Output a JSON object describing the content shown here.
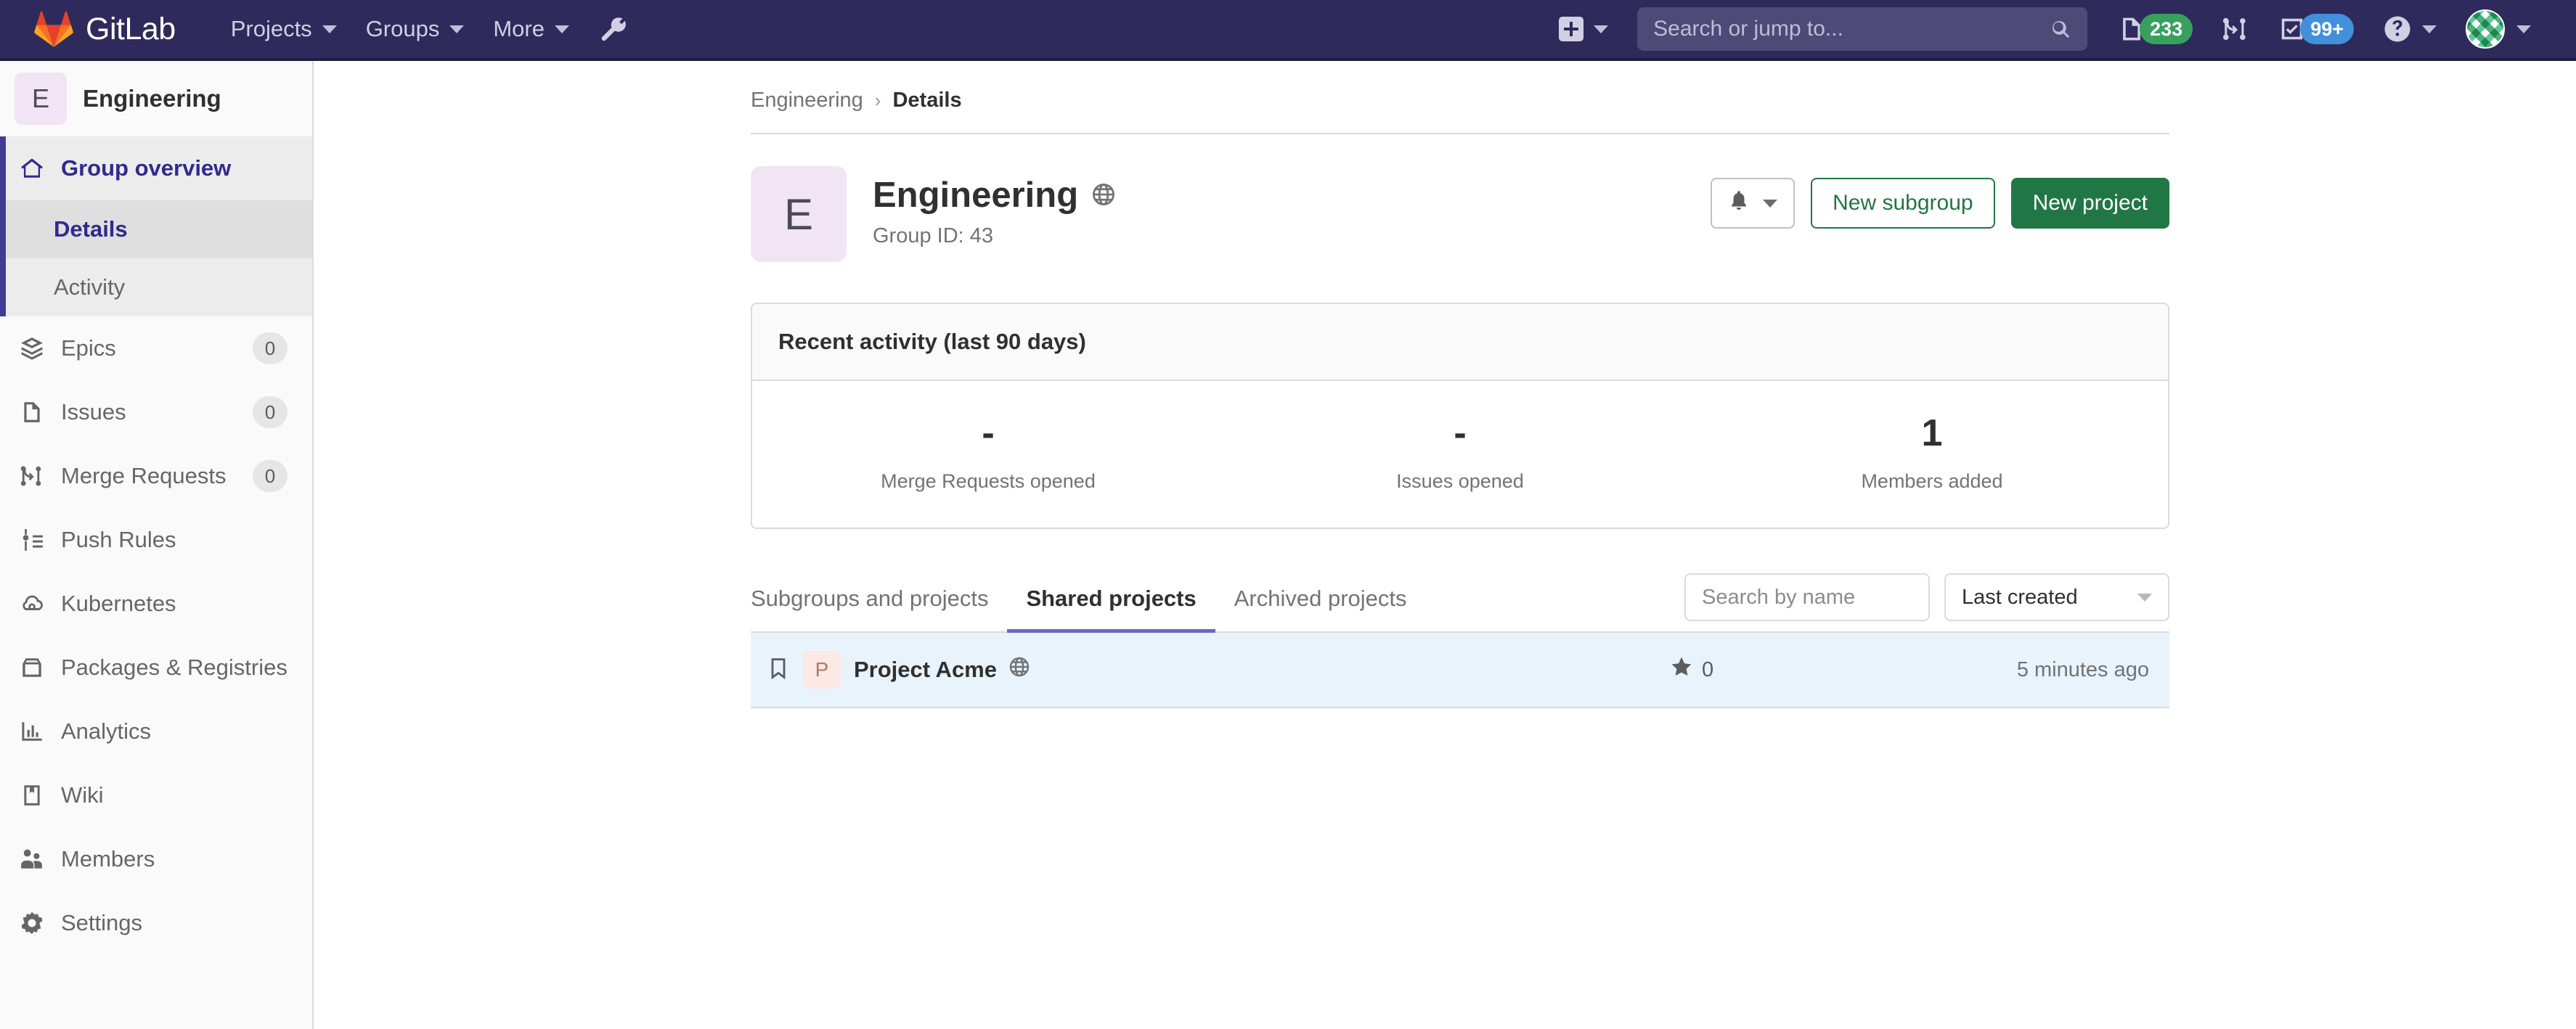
{
  "navbar": {
    "brand": "GitLab",
    "items": [
      {
        "label": "Projects",
        "icon": "chevron-down-icon"
      },
      {
        "label": "Groups",
        "icon": "chevron-down-icon"
      },
      {
        "label": "More",
        "icon": "chevron-down-icon"
      }
    ],
    "wrench_icon": "wrench-icon",
    "create_icon": "plus-square-icon",
    "search": {
      "placeholder": "Search or jump to...",
      "value": "",
      "icon": "search-icon"
    },
    "issues": {
      "icon": "issues-icon",
      "badge": "233",
      "badge_color": "#37a05d"
    },
    "merge_requests": {
      "icon": "merge-request-icon"
    },
    "todos": {
      "icon": "todo-checkbox-icon",
      "badge": "99+",
      "badge_color": "#428fdc"
    },
    "help": {
      "icon": "question-circle-icon"
    },
    "user": {
      "icon": "avatar"
    },
    "background": "#2e2a5b"
  },
  "sidebar": {
    "group": {
      "initial": "E",
      "name": "Engineering"
    },
    "overview": {
      "label": "Group overview",
      "icon": "home-icon",
      "children": [
        {
          "label": "Details",
          "current": true
        },
        {
          "label": "Activity",
          "current": false
        }
      ]
    },
    "items": [
      {
        "label": "Epics",
        "icon": "epic-icon",
        "count": "0"
      },
      {
        "label": "Issues",
        "icon": "issue-icon",
        "count": "0"
      },
      {
        "label": "Merge Requests",
        "icon": "merge-request-icon",
        "count": "0"
      },
      {
        "label": "Push Rules",
        "icon": "push-rules-icon",
        "count": ""
      },
      {
        "label": "Kubernetes",
        "icon": "kubernetes-icon",
        "count": ""
      },
      {
        "label": "Packages & Registries",
        "icon": "package-icon",
        "count": ""
      },
      {
        "label": "Analytics",
        "icon": "chart-icon",
        "count": ""
      },
      {
        "label": "Wiki",
        "icon": "book-icon",
        "count": ""
      },
      {
        "label": "Members",
        "icon": "users-icon",
        "count": ""
      },
      {
        "label": "Settings",
        "icon": "gear-icon",
        "count": ""
      }
    ]
  },
  "breadcrumb": {
    "parent": "Engineering",
    "separator": "›",
    "current": "Details"
  },
  "group_header": {
    "initial": "E",
    "title": "Engineering",
    "visibility_icon": "globe-icon",
    "subtitle": "Group ID: 43",
    "notification_icon": "bell-icon",
    "notification_caret": "chevron-down-icon",
    "new_subgroup_label": "New subgroup",
    "new_project_label": "New project",
    "accent_green": "#217645"
  },
  "activity_card": {
    "title": "Recent activity (last 90 days)",
    "stats": [
      {
        "value": "-",
        "label": "Merge Requests opened"
      },
      {
        "value": "-",
        "label": "Issues opened"
      },
      {
        "value": "1",
        "label": "Members added"
      }
    ]
  },
  "project_tabs": {
    "tabs": [
      {
        "label": "Subgroups and projects",
        "active": false
      },
      {
        "label": "Shared projects",
        "active": true
      },
      {
        "label": "Archived projects",
        "active": false
      }
    ],
    "active_underline_color": "#6b64c8",
    "search": {
      "placeholder": "Search by name",
      "value": ""
    },
    "sort": {
      "selected": "Last created",
      "icon": "chevron-down-icon"
    }
  },
  "projects": [
    {
      "bookmark_icon": "bookmark-icon",
      "initial": "P",
      "name": "Project Acme",
      "visibility_icon": "globe-icon",
      "star_icon": "star-icon",
      "stars": "0",
      "updated": "5 minutes ago"
    }
  ]
}
